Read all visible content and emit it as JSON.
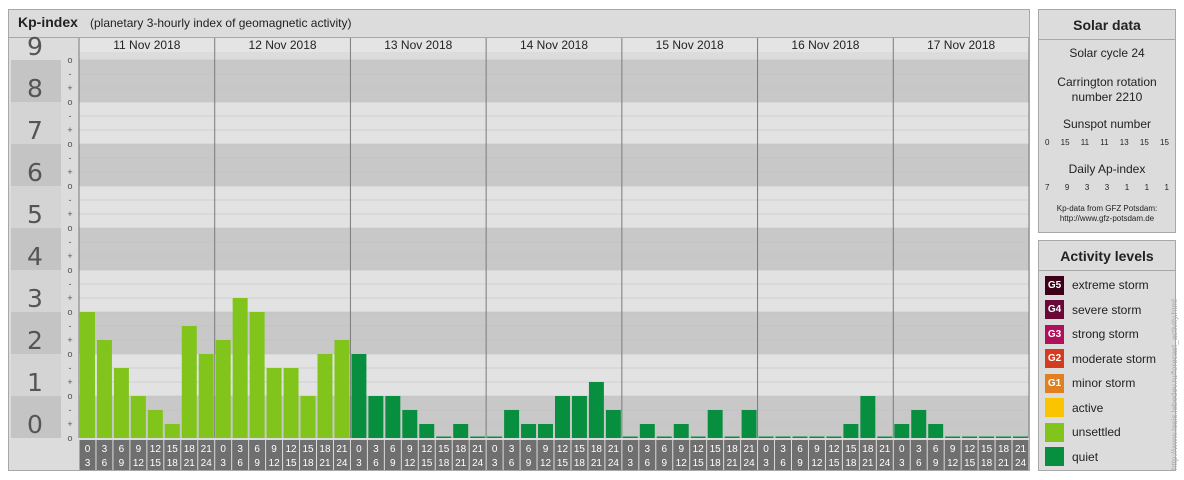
{
  "header": {
    "title": "Kp-index",
    "subtitle": "(planetary 3-hourly index of geomagnetic activity)"
  },
  "chart_data": {
    "type": "bar",
    "title": "Kp-index",
    "subtitle": "(planetary 3-hourly index of geomagnetic activity)",
    "ylim": [
      0,
      9
    ],
    "y_major_ticks": [
      "0",
      "1",
      "2",
      "3",
      "4",
      "5",
      "6",
      "7",
      "8",
      "9"
    ],
    "y_minor_ticks": [
      "o",
      "+",
      "-"
    ],
    "days": [
      "11 Nov 2018",
      "12 Nov 2018",
      "13 Nov 2018",
      "14 Nov 2018",
      "15 Nov 2018",
      "16 Nov 2018",
      "17 Nov 2018"
    ],
    "interval_start_labels": [
      "0",
      "3",
      "6",
      "9",
      "12",
      "15",
      "18",
      "21"
    ],
    "interval_end_labels": [
      "3",
      "6",
      "9",
      "12",
      "15",
      "18",
      "21",
      "24"
    ],
    "values": [
      [
        3.0,
        2.333,
        1.667,
        1.0,
        0.667,
        0.333,
        2.667,
        2.0
      ],
      [
        2.333,
        3.333,
        3.0,
        1.667,
        1.667,
        1.0,
        2.0,
        2.333
      ],
      [
        2.0,
        1.0,
        1.0,
        0.667,
        0.333,
        0.0,
        0.333,
        0.0
      ],
      [
        0.0,
        0.667,
        0.333,
        0.333,
        1.0,
        1.0,
        1.333,
        0.667
      ],
      [
        0.0,
        0.333,
        0.0,
        0.333,
        0.0,
        0.667,
        0.0,
        0.667
      ],
      [
        0.0,
        0.0,
        0.0,
        0.0,
        0.0,
        0.333,
        1.0,
        0.0
      ],
      [
        0.333,
        0.667,
        0.333,
        0.0,
        0.0,
        0.0,
        0.0,
        0.0
      ]
    ],
    "categories_by_level": {
      "quiet_max": 2,
      "unsettled": 3,
      "active": 4,
      "minor_storm": 5,
      "moderate_storm": 6,
      "strong_storm": 7,
      "severe_storm": 8,
      "extreme_storm": 9
    },
    "colors": {
      "quiet": "#088e3f",
      "unsettled": "#80c41c",
      "active": "#fbc400",
      "minor_storm": "#e08020",
      "moderate_storm": "#d43c20",
      "strong_storm": "#b0105a",
      "severe_storm": "#6a0838",
      "extreme_storm": "#3c0018"
    },
    "grid": true,
    "legend": "right"
  },
  "solar": {
    "title": "Solar data",
    "cycle_text": "Solar cycle 24",
    "rotation_line1": "Carrington rotation",
    "rotation_line2": "number 2210",
    "sunspot_title": "Sunspot number",
    "sunspot_values": [
      "0",
      "15",
      "11",
      "11",
      "13",
      "15",
      "15"
    ],
    "ap_title": "Daily Ap-index",
    "ap_values": [
      "7",
      "9",
      "3",
      "3",
      "1",
      "1",
      "1"
    ],
    "credit_line1": "Kp-data from GFZ Potsdam:",
    "credit_line2": "http://www.gfz-potsdam.de"
  },
  "activity": {
    "title": "Activity levels",
    "levels": [
      {
        "badge": "G5",
        "label": "extreme storm",
        "color": "#3c0018"
      },
      {
        "badge": "G4",
        "label": "severe storm",
        "color": "#6a0838"
      },
      {
        "badge": "G3",
        "label": "strong storm",
        "color": "#b0105a"
      },
      {
        "badge": "G2",
        "label": "moderate storm",
        "color": "#d43c20"
      },
      {
        "badge": "G1",
        "label": "minor storm",
        "color": "#e08020"
      },
      {
        "badge": "",
        "label": "active",
        "color": "#fbc400"
      },
      {
        "badge": "",
        "label": "unsettled",
        "color": "#80c41c"
      },
      {
        "badge": "",
        "label": "quiet",
        "color": "#088e3f"
      }
    ]
  },
  "watermark": "http://www.tesis.lebedev.ru/forecast_activity.html"
}
